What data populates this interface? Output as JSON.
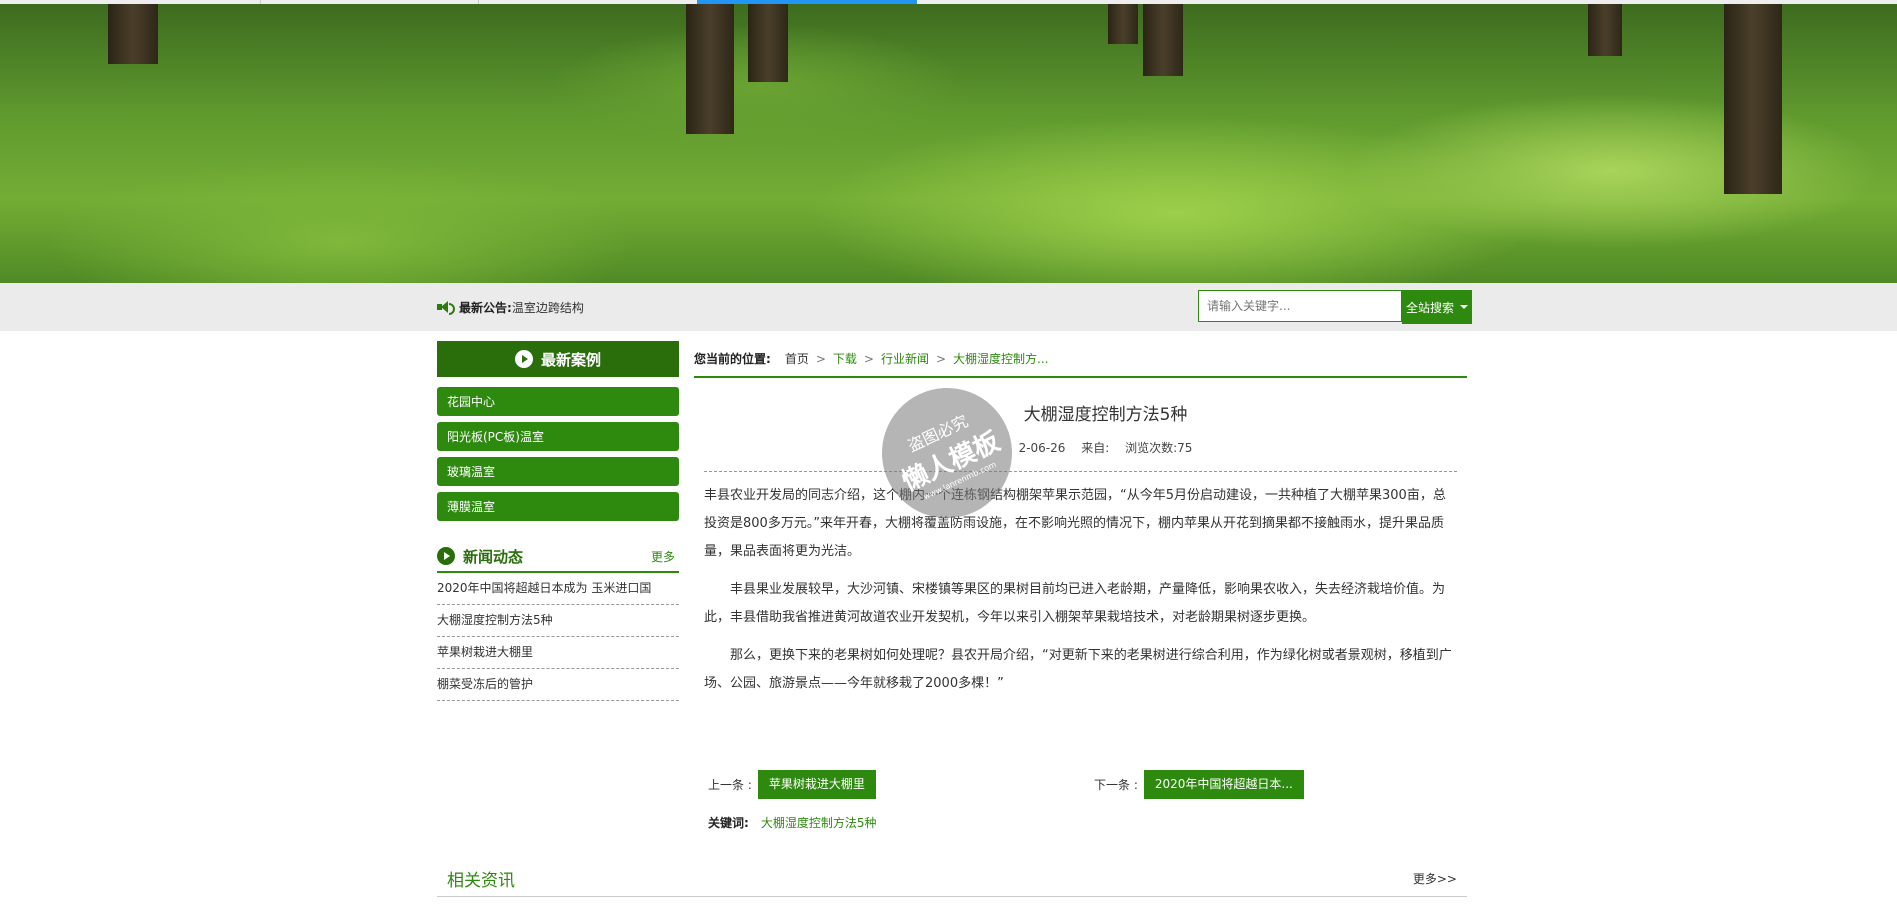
{
  "colors": {
    "accent": "#2d8a0e",
    "accent_dark": "#2a6e0c",
    "tab_highlight": "#2196f3"
  },
  "notice": {
    "label": "最新公告:",
    "text": "温室边跨结构"
  },
  "search": {
    "placeholder": "请输入关键字...",
    "button": "全站搜索"
  },
  "sidebar": {
    "cases_title": "最新案例",
    "cases": [
      "花园中心",
      "阳光板(PC板)温室",
      "玻璃温室",
      "薄膜温室"
    ],
    "news_title": "新闻动态",
    "news_more": "更多",
    "news": [
      "2020年中国将超越日本成为 玉米进口国",
      "大棚湿度控制方法5种",
      "苹果树栽进大棚里",
      "棚菜受冻后的管护"
    ]
  },
  "breadcrumb": {
    "label": "您当前的位置:",
    "items": [
      "首页",
      "下载",
      "行业新闻",
      "大棚湿度控制方..."
    ]
  },
  "article": {
    "title": "大棚湿度控制方法5种",
    "date": "2-06-26",
    "source": "来自:",
    "views": "浏览次数:75",
    "paragraphs": [
      "丰县农业开发局的同志介绍，这个棚内一个连栋钢结构棚架苹果示范园，“从今年5月份启动建设，一共种植了大棚苹果300亩，总投资是800多万元。”来年开春，大棚将覆盖防雨设施，在不影响光照的情况下，棚内苹果从开花到摘果都不接触雨水，提升果品质量，果品表面将更为光洁。",
      "丰县果业发展较早，大沙河镇、宋楼镇等果区的果树目前均已进入老龄期，产量降低，影响果农收入，失去经济栽培价值。为此，丰县借助我省推进黄河故道农业开发契机，今年以来引入棚架苹果栽培技术，对老龄期果树逐步更换。",
      "那么，更换下来的老果树如何处理呢？县农开局介绍，“对更新下来的老果树进行综合利用，作为绿化树或者景观树，移植到广场、公园、旅游景点——今年就移栽了2000多棵！”"
    ]
  },
  "watermark": {
    "line1": "盗图必究",
    "line2": "懒人模板",
    "line3": "www.lanrenmb.com"
  },
  "prev": {
    "label": "上一条 :",
    "title": "苹果树栽进大棚里"
  },
  "next": {
    "label": "下一条 :",
    "title": "2020年中国将超越日本..."
  },
  "keywords": {
    "label": "关键词:",
    "value": "大棚湿度控制方法5种"
  },
  "related": {
    "title": "相关资讯",
    "more": "更多>>"
  }
}
